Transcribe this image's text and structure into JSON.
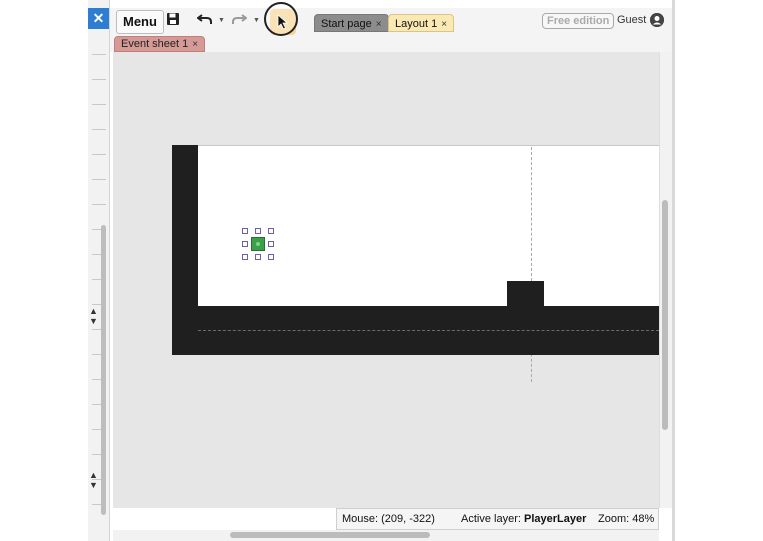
{
  "window": {
    "close_icon": "close-icon"
  },
  "toolbar": {
    "menu_label": "Menu",
    "save_icon": "save-icon",
    "undo_icon": "undo-icon",
    "redo_icon": "redo-icon",
    "select_tool_icon": "cursor-icon",
    "tabs": [
      {
        "label": "Start page",
        "close": "×"
      },
      {
        "label": "Layout 1",
        "close": "×"
      }
    ],
    "free_edition": "Free edition",
    "user": "Guest"
  },
  "tabs2": [
    {
      "label": "Event sheet 1",
      "close": "×"
    }
  ],
  "status": {
    "mouse": "Mouse: (209, -322)",
    "active_layer_label": "Active layer:",
    "active_layer_value": "PlayerLayer",
    "zoom": "Zoom: 48%"
  },
  "colors": {
    "accent_blue": "#2d7dd2",
    "layout_tab": "#fbe9b4",
    "event_tab": "#d69a96",
    "player": "#3aa04a",
    "solid": "#1f1f1f"
  }
}
